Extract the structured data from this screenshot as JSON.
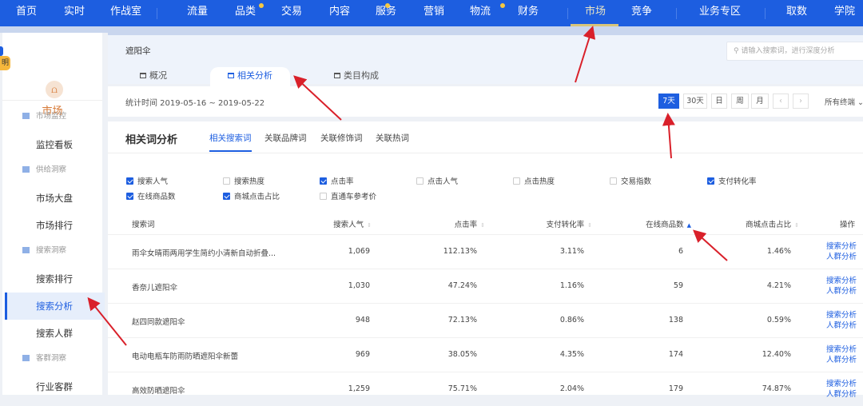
{
  "nav": {
    "items": [
      "首页",
      "实时",
      "作战室",
      "流量",
      "品类",
      "交易",
      "内容",
      "服务",
      "营销",
      "物流",
      "财务",
      "市场",
      "竞争",
      "业务专区",
      "取数",
      "学院"
    ],
    "active": "市场"
  },
  "side": {
    "badge": "明",
    "module": "市场",
    "module_icon": "market-chart-icon",
    "groups": [
      {
        "title": "市场监控",
        "items": [
          "监控看板"
        ]
      },
      {
        "title": "供给洞察",
        "items": [
          "市场大盘",
          "市场排行"
        ]
      },
      {
        "title": "搜索洞察",
        "items": [
          "搜索排行",
          "搜索分析",
          "搜索人群"
        ]
      },
      {
        "title": "客群洞察",
        "items": [
          "行业客群"
        ]
      }
    ],
    "active": "搜索分析"
  },
  "header": {
    "keyword": "遮阳伞",
    "search_placeholder": "请输入搜索词，进行深度分析",
    "tabs": [
      "概况",
      "相关分析",
      "类目构成"
    ],
    "active_tab": "相关分析"
  },
  "filter": {
    "stat_time": "统计时间 2019-05-16 ~ 2019-05-22",
    "periods": [
      "7天",
      "30天",
      "日",
      "周",
      "月"
    ],
    "active_period": "7天",
    "prev": "‹",
    "next": "›",
    "terminal": "所有终端 ⌄"
  },
  "panel": {
    "title": "相关词分析",
    "tabs": [
      "相关搜索词",
      "关联品牌词",
      "关联修饰词",
      "关联热词"
    ],
    "checkboxes": [
      {
        "label": "搜索人气",
        "checked": true
      },
      {
        "label": "搜索热度",
        "checked": false
      },
      {
        "label": "点击率",
        "checked": true
      },
      {
        "label": "点击人气",
        "checked": false
      },
      {
        "label": "点击热度",
        "checked": false
      },
      {
        "label": "交易指数",
        "checked": false
      },
      {
        "label": "支付转化率",
        "checked": true
      },
      {
        "label": "在线商品数",
        "checked": true
      },
      {
        "label": "商城点击占比",
        "checked": true
      },
      {
        "label": "直通车参考价",
        "checked": false
      }
    ],
    "columns": [
      "搜索词",
      "搜索人气",
      "点击率",
      "支付转化率",
      "在线商品数",
      "商城点击占比",
      "操作"
    ],
    "rows": [
      [
        "雨伞女晴雨两用学生简约小清新自动折叠...",
        "1,069",
        "112.13%",
        "3.11%",
        "6",
        "1.46%"
      ],
      [
        "香奈儿遮阳伞",
        "1,030",
        "47.24%",
        "1.16%",
        "59",
        "4.21%"
      ],
      [
        "赵四同款遮阳伞",
        "948",
        "72.13%",
        "0.86%",
        "138",
        "0.59%"
      ],
      [
        "电动电瓶车防雨防晒遮阳伞新蕾",
        "969",
        "38.05%",
        "4.35%",
        "174",
        "12.40%"
      ],
      [
        "高效防晒遮阳伞",
        "1,259",
        "75.71%",
        "2.04%",
        "179",
        "74.87%"
      ]
    ],
    "ops": [
      "搜索分析",
      "人群分析"
    ]
  },
  "colors": {
    "brand": "#1d5ee0",
    "annotation": "#d9202a"
  }
}
